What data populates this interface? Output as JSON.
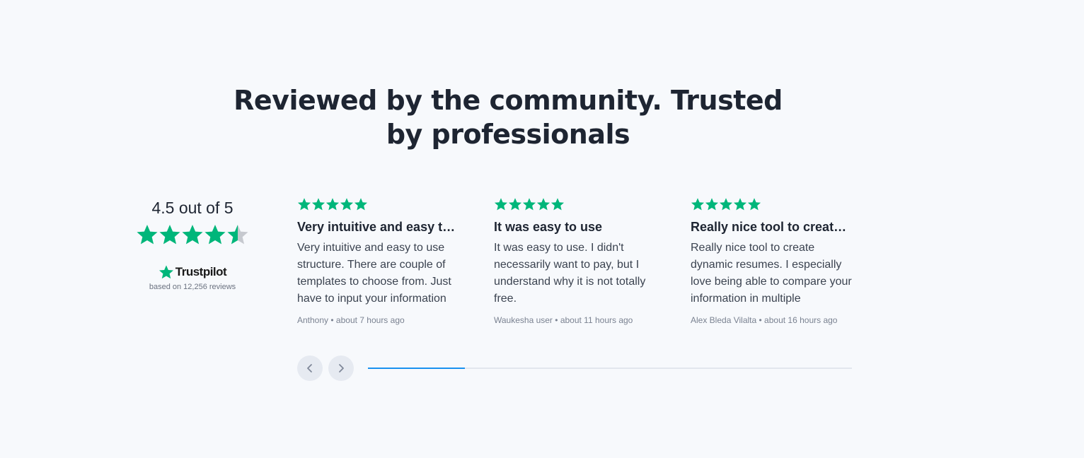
{
  "headline": "Reviewed by the community. Trusted by professionals",
  "summary": {
    "score_text": "4.5 out of 5",
    "rating": 4.5,
    "brand": "Trustpilot",
    "based_on": "based on 12,256 reviews"
  },
  "colors": {
    "star_green": "#00b67a",
    "star_grey": "#c6c9cf",
    "progress": "#1a91f0"
  },
  "reviews": [
    {
      "rating": 5,
      "title": "Very intuitive and easy to use structure",
      "body": "Very intuitive and easy to use structure. There are couple of templates to choose from. Just have to input your information",
      "author": "Anthony",
      "time": "about 7 hours ago"
    },
    {
      "rating": 5,
      "title": "It was easy to use",
      "body": "It was easy to use. I didn't necessarily want to pay, but I understand why it is not totally free.",
      "author": "Waukesha user",
      "time": "about 11 hours ago"
    },
    {
      "rating": 5,
      "title": "Really nice tool to create dynamic resumes",
      "body": "Really nice tool to create dynamic resumes. I especially love being able to compare your information in multiple",
      "author": "Alex Bleda Vilalta",
      "time": "about 16 hours ago"
    }
  ],
  "carousel": {
    "prev_icon": "chevron-left-icon",
    "next_icon": "chevron-right-icon",
    "progress": 0.2
  }
}
